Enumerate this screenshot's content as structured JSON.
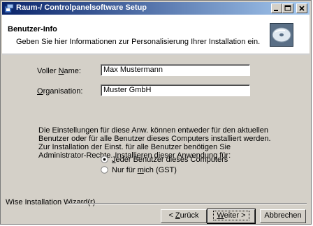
{
  "window": {
    "title": "Raum-/ Controlpanelsoftware Setup",
    "controls": {
      "minimize": "minimize",
      "maximize": "maximize",
      "close": "close"
    }
  },
  "header": {
    "title": "Benutzer-Info",
    "subtitle": "Geben Sie hier Informationen zur Personalisierung Ihrer Installation ein."
  },
  "form": {
    "name_label_pre": "Voller ",
    "name_label_key": "N",
    "name_label_post": "ame:",
    "name_value": "Max Mustermann",
    "org_label_key": "O",
    "org_label_post": "rganisation:",
    "org_value": "Muster GmbH"
  },
  "info_text": "Die Einstellungen für diese Anw. können entweder für den aktuellen Benutzer oder für alle Benutzer dieses Computers installiert werden. Zur Installation der Einst. für alle Benutzer benötigen Sie Administrator-Rechte. Installieren dieser Anwendung für:",
  "radio": {
    "option1_key": "J",
    "option1_post": "eder Benutzer dieses Computers",
    "option1_checked": true,
    "option2_pre": "Nur für ",
    "option2_key": "m",
    "option2_post": "ich (GST)",
    "option2_checked": false
  },
  "footer": {
    "brand": "Wise Installation Wizard(r)",
    "back_pre": "< ",
    "back_key": "Z",
    "back_post": "urück",
    "next_key": "W",
    "next_post": "eiter >",
    "cancel": "Abbrechen"
  }
}
